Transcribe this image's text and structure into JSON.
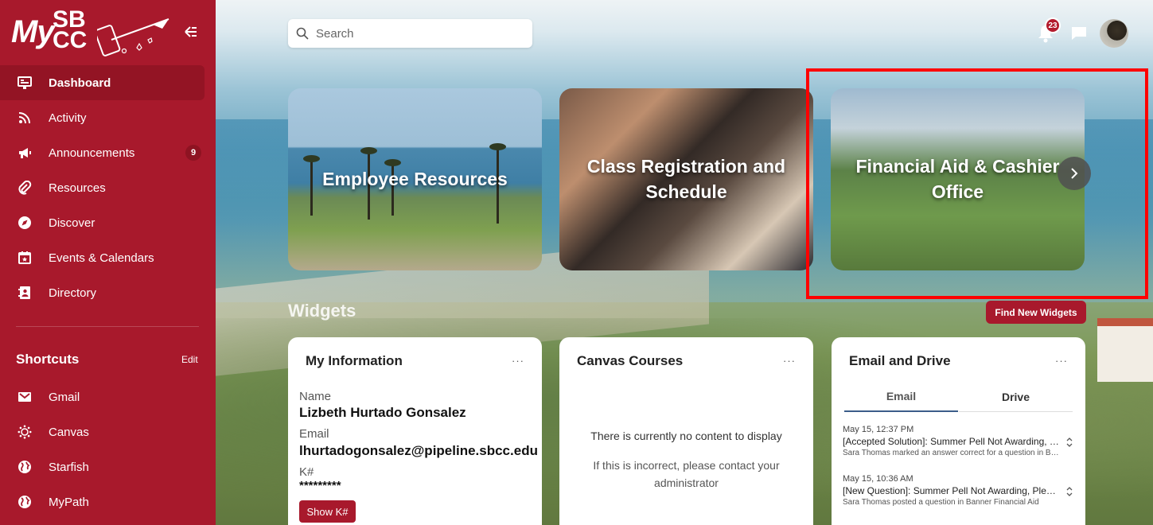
{
  "brand": {
    "logo_my": "My",
    "logo_sb": "SB",
    "logo_cc": "CC",
    "accent": "#a8192c"
  },
  "search": {
    "placeholder": "Search"
  },
  "notifications": {
    "count": "23"
  },
  "nav": [
    {
      "label": "Dashboard",
      "icon": "dashboard-icon",
      "active": true
    },
    {
      "label": "Activity",
      "icon": "rss-icon"
    },
    {
      "label": "Announcements",
      "icon": "megaphone-icon",
      "badge": "9"
    },
    {
      "label": "Resources",
      "icon": "paperclip-icon"
    },
    {
      "label": "Discover",
      "icon": "compass-icon"
    },
    {
      "label": "Events & Calendars",
      "icon": "calendar-icon"
    },
    {
      "label": "Directory",
      "icon": "contacts-icon"
    }
  ],
  "shortcuts": {
    "title": "Shortcuts",
    "edit": "Edit",
    "items": [
      {
        "label": "Gmail",
        "icon": "mail-icon"
      },
      {
        "label": "Canvas",
        "icon": "canvas-icon"
      },
      {
        "label": "Starfish",
        "icon": "globe-icon"
      },
      {
        "label": "MyPath",
        "icon": "globe-icon"
      }
    ]
  },
  "carousel": [
    {
      "title": "Employee Resources"
    },
    {
      "title": "Class Registration and Schedule"
    },
    {
      "title": "Financial Aid & Cashier Office"
    }
  ],
  "widgets": {
    "title": "Widgets",
    "find_button": "Find New Widgets",
    "my_info": {
      "title": "My Information",
      "menu": "···",
      "name_label": "Name",
      "name_value": "Lizbeth Hurtado Gonsalez",
      "email_label": "Email",
      "email_value": "lhurtadogonsalez@pipeline.sbcc.edu",
      "k_label": "K#",
      "k_value": "*********",
      "show_button": "Show K#"
    },
    "canvas": {
      "title": "Canvas Courses",
      "menu": "···",
      "empty": "There is currently no content to display",
      "contact": "If this is incorrect, please contact your administrator"
    },
    "email_drive": {
      "title": "Email and Drive",
      "menu": "···",
      "tabs": [
        "Email",
        "Drive"
      ],
      "messages": [
        {
          "time": "May 15, 12:37 PM",
          "subject": "[Accepted Solution]: Summer Pell Not Awarding, Please Help",
          "preview": "Sara Thomas marked an answer correct for a question in Banner Financial Aid"
        },
        {
          "time": "May 15, 10:36 AM",
          "subject": "[New Question]: Summer Pell Not Awarding, Please Help",
          "preview": "Sara Thomas posted a question in Banner Financial Aid"
        }
      ]
    }
  }
}
